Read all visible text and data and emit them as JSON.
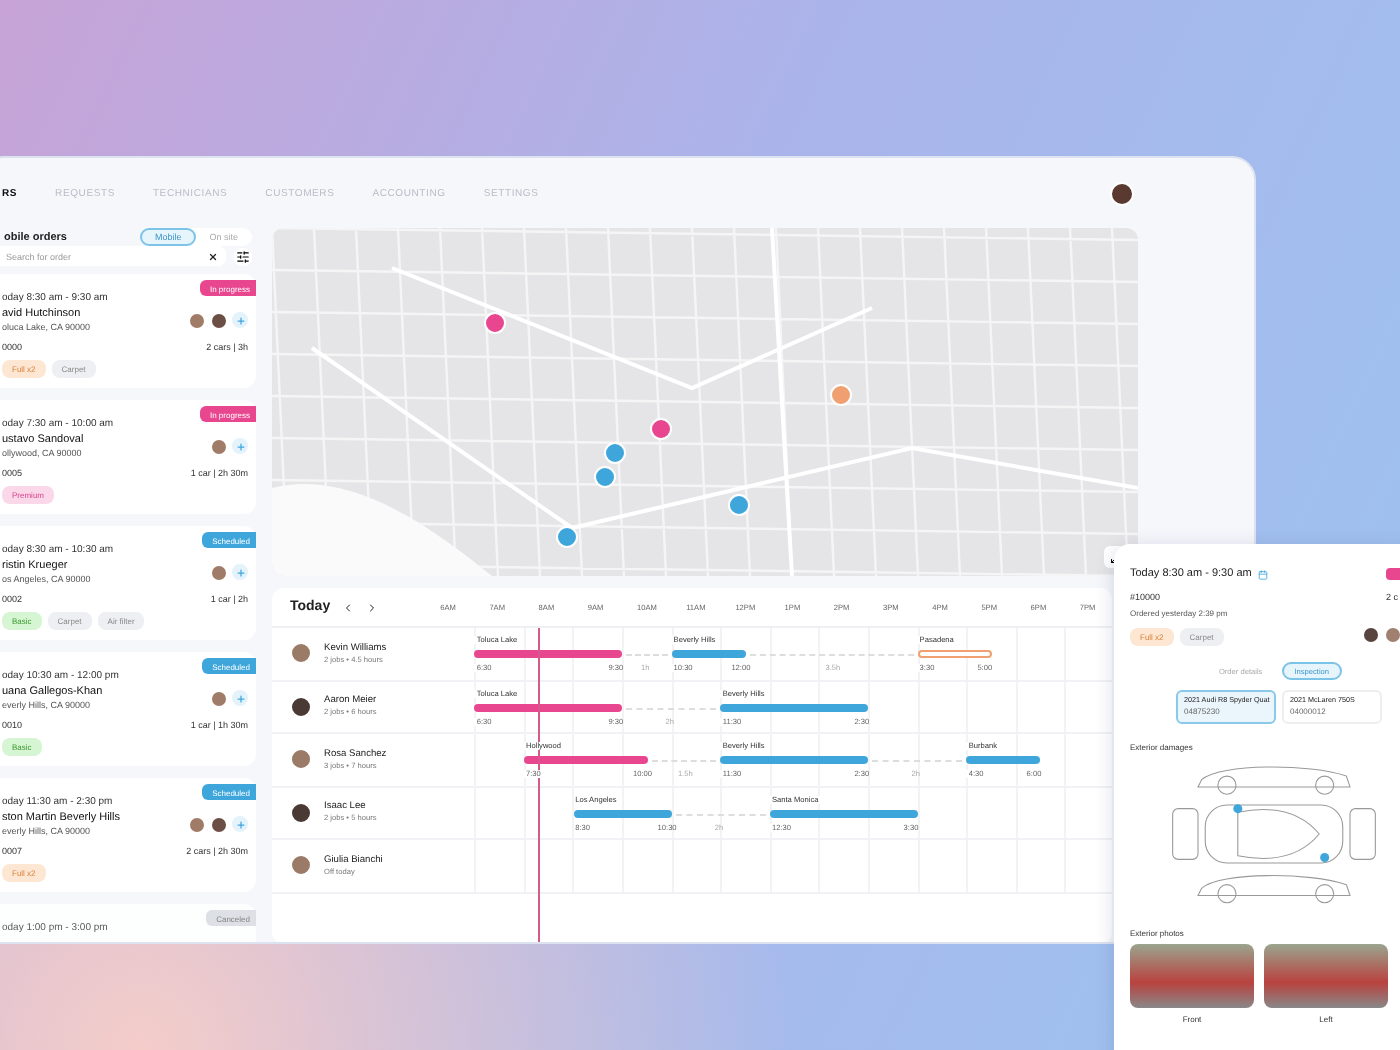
{
  "nav": {
    "tabs": [
      {
        "label": "RS",
        "selected": true
      },
      {
        "label": "REQUESTS",
        "selected": false
      },
      {
        "label": "TECHNICIANS",
        "selected": false
      },
      {
        "label": "CUSTOMERS",
        "selected": false
      },
      {
        "label": "ACCOUNTING",
        "selected": false
      },
      {
        "label": "SETTINGS",
        "selected": false
      }
    ]
  },
  "orders_panel": {
    "title": "obile orders",
    "view_toggle": [
      {
        "label": "Mobile",
        "selected": true
      },
      {
        "label": "On site",
        "selected": false
      }
    ],
    "search": {
      "placeholder": "Search for order"
    }
  },
  "orders": [
    {
      "kind": "in_progress",
      "badge": "In progress",
      "time": "oday 8:30 am - 9:30 am",
      "name": "avid Hutchinson",
      "address": "oluca Lake, CA 90000",
      "number": "0000",
      "summary": "2 cars | 3h",
      "assignees": [
        {
          "kind": "photo"
        },
        {
          "kind": "photo"
        }
      ],
      "tags": [
        {
          "label": "Full x2",
          "kind": "full"
        },
        {
          "label": "Carpet",
          "kind": "extra"
        }
      ]
    },
    {
      "kind": "in_progress",
      "badge": "In progress",
      "time": "oday 7:30 am - 10:00 am",
      "name": "ustavo Sandoval",
      "address": "ollywood, CA 90000",
      "number": "0005",
      "summary": "1 car | 2h 30m",
      "assignees": [
        {
          "kind": "photo"
        }
      ],
      "tags": [
        {
          "label": "Premium",
          "kind": "premium"
        }
      ]
    },
    {
      "kind": "scheduled",
      "badge": "Scheduled",
      "time": "oday 8:30 am - 10:30 am",
      "name": "ristin Krueger",
      "address": "os Angeles, CA 90000",
      "number": "0002",
      "summary": "1 car | 2h",
      "assignees": [
        {
          "kind": "photo"
        }
      ],
      "tags": [
        {
          "label": "Basic",
          "kind": "basic"
        },
        {
          "label": "Carpet",
          "kind": "extra"
        },
        {
          "label": "Air filter",
          "kind": "extra"
        }
      ]
    },
    {
      "kind": "scheduled",
      "badge": "Scheduled",
      "time": "oday 10:30 am - 12:00 pm",
      "name": "uana Gallegos-Khan",
      "address": "everly Hills, CA 90000",
      "number": "0010",
      "summary": "1 car | 1h 30m",
      "assignees": [
        {
          "kind": "photo"
        }
      ],
      "tags": [
        {
          "label": "Basic",
          "kind": "basic"
        }
      ]
    },
    {
      "kind": "scheduled",
      "badge": "Scheduled",
      "time": "oday 11:30 am - 2:30 pm",
      "name": "ston Martin Beverly Hills",
      "address": "everly Hills, CA 90000",
      "number": "0007",
      "summary": "2 cars | 2h 30m",
      "assignees": [
        {
          "kind": "photo"
        },
        {
          "kind": "photo"
        }
      ],
      "tags": [
        {
          "label": "Full x2",
          "kind": "full"
        }
      ]
    },
    {
      "kind": "canceled",
      "badge": "Canceled",
      "time": "oday 1:00 pm - 3:00 pm"
    }
  ],
  "map": {
    "pins": [
      {
        "kind": "in_progress"
      },
      {
        "kind": "in_progress"
      },
      {
        "kind": "scheduled"
      },
      {
        "kind": "scheduled"
      },
      {
        "kind": "pending"
      },
      {
        "kind": "scheduled"
      },
      {
        "kind": "scheduled"
      }
    ]
  },
  "schedule": {
    "title": "Today",
    "hours": [
      "6AM",
      "7AM",
      "8AM",
      "9AM",
      "10AM",
      "11AM",
      "12PM",
      "1PM",
      "2PM",
      "3PM",
      "4PM",
      "5PM",
      "6PM",
      "7PM"
    ],
    "technicians": [
      {
        "name": "Kevin Williams",
        "summary": "2 jobs • 4.5 hours",
        "jobs": [
          {
            "location": "Toluca Lake",
            "start": "6:30",
            "end": "9:30",
            "kind": "in_progress"
          },
          {
            "location": "Beverly Hills",
            "start": "10:30",
            "end": "12:00",
            "kind": "scheduled"
          },
          {
            "location": "Pasadena",
            "start": "3:30",
            "end": "5:00",
            "kind": "pending"
          }
        ],
        "gaps": [
          "1h",
          "3.5h"
        ]
      },
      {
        "name": "Aaron Meier",
        "summary": "2 jobs • 6 hours",
        "jobs": [
          {
            "location": "Toluca Lake",
            "start": "6:30",
            "end": "9:30",
            "kind": "in_progress"
          },
          {
            "location": "Beverly Hills",
            "start": "11:30",
            "end": "2:30",
            "kind": "scheduled"
          }
        ],
        "gaps": [
          "2h"
        ]
      },
      {
        "name": "Rosa Sanchez",
        "summary": "3 jobs • 7 hours",
        "jobs": [
          {
            "location": "Hollywood",
            "start": "7:30",
            "end": "10:00",
            "kind": "in_progress"
          },
          {
            "location": "Beverly Hills",
            "start": "11:30",
            "end": "2:30",
            "kind": "scheduled"
          },
          {
            "location": "Burbank",
            "start": "4:30",
            "end": "6:00",
            "kind": "scheduled"
          }
        ],
        "gaps": [
          "1.5h",
          "2h"
        ]
      },
      {
        "name": "Isaac Lee",
        "summary": "2 jobs • 5 hours",
        "jobs": [
          {
            "location": "Los Angeles",
            "start": "8:30",
            "end": "10:30",
            "kind": "scheduled"
          },
          {
            "location": "Santa Monica",
            "start": "12:30",
            "end": "3:30",
            "kind": "scheduled"
          }
        ],
        "gaps": [
          "2h"
        ]
      },
      {
        "name": "Giulia Bianchi",
        "summary": "Off today"
      }
    ]
  },
  "detail": {
    "time": "Today 8:30 am - 9:30 am",
    "kind": "in_progress",
    "number": "#10000",
    "ordered": "Ordered yesterday 2:39 pm",
    "summary": "2 c",
    "tags": [
      {
        "label": "Full x2",
        "kind": "full"
      },
      {
        "label": "Carpet",
        "kind": "extra"
      }
    ],
    "tabs": [
      {
        "label": "Order details",
        "selected": false
      },
      {
        "label": "Inspection",
        "selected": true
      }
    ],
    "vehicles": [
      {
        "name": "2021 Audi R8 Spyder Quat",
        "plate": "04875230",
        "selected": true
      },
      {
        "name": "2021 McLaren 750S",
        "plate": "04000012",
        "selected": false
      }
    ],
    "damages_title": "Exterior damages",
    "photos_title": "Exterior photos",
    "photos": [
      {
        "label": "Front"
      },
      {
        "label": "Left"
      }
    ]
  }
}
